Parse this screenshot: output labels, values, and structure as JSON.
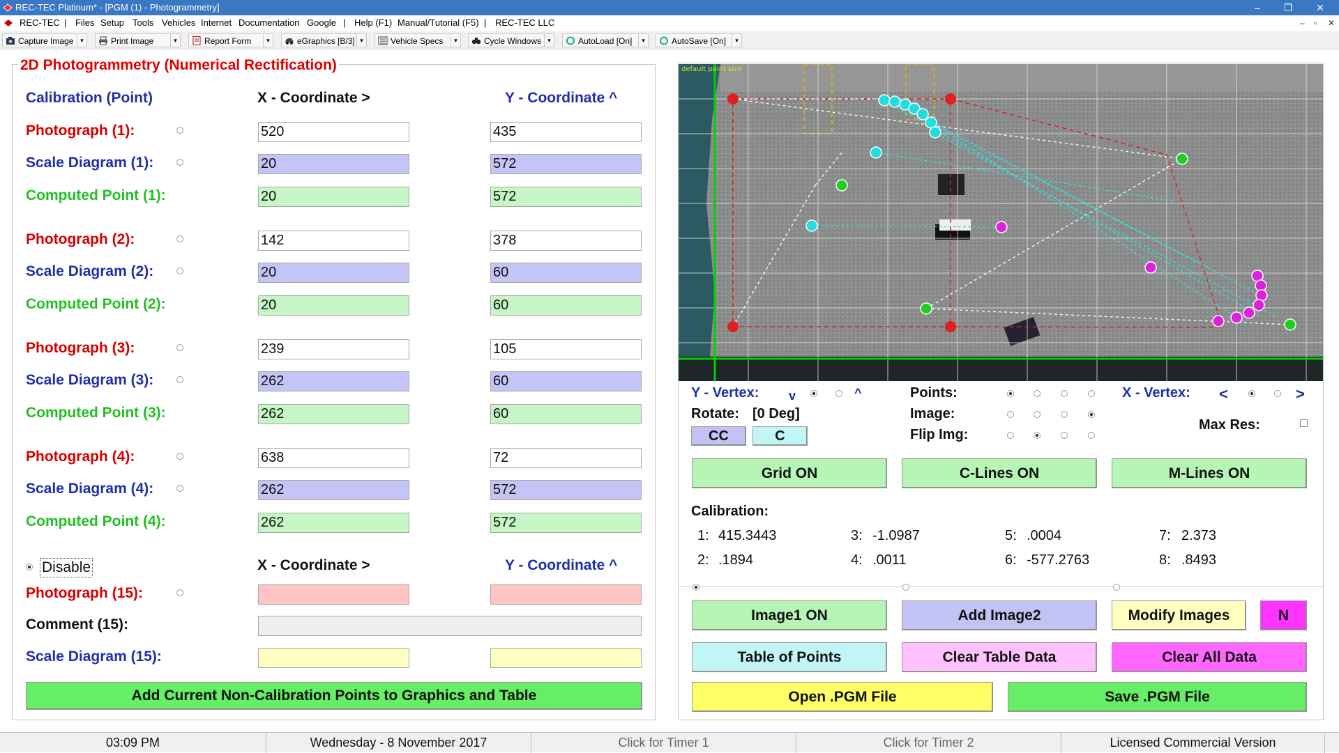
{
  "window": {
    "title": "REC-TEC Platinum* - [PGM (1) - Photogrammetry]",
    "controls": [
      "–",
      "❐",
      "✕"
    ],
    "mdi_controls": [
      "–",
      "▫",
      "✕"
    ]
  },
  "menu": {
    "items": [
      "REC-TEC",
      "|",
      "Files",
      "Setup",
      "Tools",
      "Vehicles",
      "Internet",
      "Documentation",
      "Google",
      "|",
      "Help (F1)",
      "Manual/Tutorial (F5)",
      "|",
      "REC-TEC LLC"
    ]
  },
  "toolbar": {
    "capture_image": "Capture Image",
    "print_image": "Print Image",
    "report_form": "Report Form",
    "egraphics": "eGraphics [B/3]",
    "vehicle_specs": "Vehicle Specs",
    "cycle_windows": "Cycle Windows",
    "autoload": "AutoLoad [On]",
    "autosave": "AutoSave [On]",
    "dropdown_glyph": "▾"
  },
  "left": {
    "panel_title": "2D Photogrammetry (Numerical Rectification)",
    "calibration_label": "Calibration (Point)",
    "x_header": "X - Coordinate >",
    "y_header": "Y - Coordinate ^",
    "groups": [
      {
        "photo_label": "Photograph (1):",
        "photo_x": "520",
        "photo_y": "435",
        "scale_label": "Scale Diagram (1):",
        "scale_x": "20",
        "scale_y": "572",
        "computed_label": "Computed Point (1):",
        "computed_x": "20",
        "computed_y": "572"
      },
      {
        "photo_label": "Photograph (2):",
        "photo_x": "142",
        "photo_y": "378",
        "scale_label": "Scale Diagram (2):",
        "scale_x": "20",
        "scale_y": "60",
        "computed_label": "Computed Point (2):",
        "computed_x": "20",
        "computed_y": "60"
      },
      {
        "photo_label": "Photograph (3):",
        "photo_x": "239",
        "photo_y": "105",
        "scale_label": "Scale Diagram (3):",
        "scale_x": "262",
        "scale_y": "60",
        "computed_label": "Computed Point (3):",
        "computed_x": "262",
        "computed_y": "60"
      },
      {
        "photo_label": "Photograph (4):",
        "photo_x": "638",
        "photo_y": "72",
        "scale_label": "Scale Diagram (4):",
        "scale_x": "262",
        "scale_y": "572",
        "computed_label": "Computed Point (4):",
        "computed_x": "262",
        "computed_y": "572"
      }
    ],
    "disable_label": "Disable",
    "photo15_label": "Photograph (15):",
    "photo15_x": "",
    "photo15_y": "",
    "comment_label": "Comment (15):",
    "comment_value": "",
    "scale15_label": "Scale Diagram (15):",
    "scale15_x": "",
    "scale15_y": "",
    "add_points_button": "Add Current Non-Calibration Points  to Graphics and Table"
  },
  "image": {
    "overlay_text": "default point size",
    "marker_glyph": "×"
  },
  "controls": {
    "y_vertex_label": "Y - Vertex:",
    "y_vertex_down": "v",
    "y_vertex_up": "^",
    "points_label": "Points:",
    "x_vertex_label": "X - Vertex:",
    "x_vertex_left": "<",
    "x_vertex_right": ">",
    "rotate_label": "Rotate:",
    "rotate_value": "[0 Deg]",
    "image_label": "Image:",
    "max_res_label": "Max Res:",
    "cc_button": "CC",
    "c_button": "C",
    "flip_label": "Flip Img:",
    "grid_button": "Grid ON",
    "clines_button": "C-Lines ON",
    "mlines_button": "M-Lines ON"
  },
  "calibration": {
    "title": "Calibration:",
    "values": [
      {
        "k": "1:",
        "v": "415.3443"
      },
      {
        "k": "2:",
        "v": ".1894"
      },
      {
        "k": "3:",
        "v": "-1.0987"
      },
      {
        "k": "4:",
        "v": ".0011"
      },
      {
        "k": "5:",
        "v": ".0004"
      },
      {
        "k": "6:",
        "v": "-577.2763"
      },
      {
        "k": "7:",
        "v": "2.373"
      },
      {
        "k": "8:",
        "v": ".8493"
      }
    ]
  },
  "bottom_buttons": {
    "image1": "Image1 ON",
    "add_image2": "Add Image2",
    "modify_images": "Modify Images",
    "n": "N",
    "table_points": "Table of Points",
    "clear_table": "Clear Table Data",
    "clear_all": "Clear All Data",
    "open_pgm": "Open .PGM File",
    "save_pgm": "Save .PGM File"
  },
  "status": {
    "time": "03:09 PM",
    "date": "Wednesday  -  8 November 2017",
    "timer1": "Click for Timer 1",
    "timer2": "Click for Timer 2",
    "license": "Licensed Commercial Version"
  },
  "colors": {
    "title_bar": "#3b78c4",
    "label_blue": "#1f2fa8",
    "label_red": "#d20000",
    "label_green": "#22c022",
    "btn_green": "#b7f5b7",
    "btn_blue": "#c2c2f4",
    "btn_yellow": "#ffffc2",
    "btn_magenta": "#ff33ff",
    "btn_cyan": "#c2f5f5",
    "btn_pink": "#ffc2ff",
    "btn_open": "#ffff66",
    "btn_save": "#66ee66"
  }
}
